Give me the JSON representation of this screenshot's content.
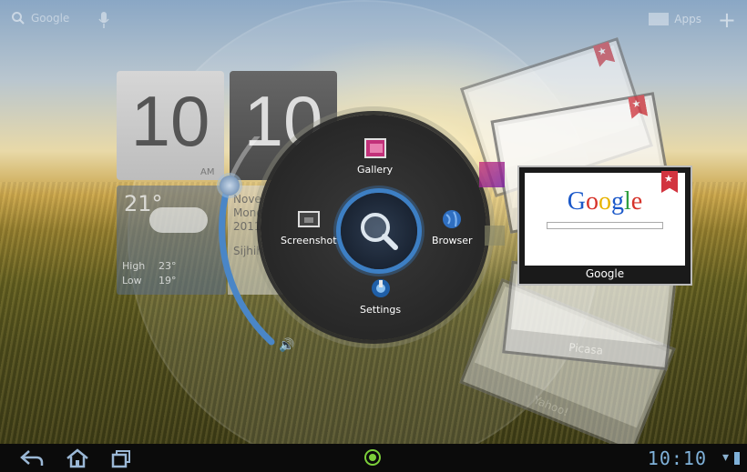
{
  "top_bar": {
    "search_label": "Google",
    "apps_label": "Apps",
    "add_glyph": "+"
  },
  "clock": {
    "hour": "10",
    "minute": "10",
    "ampm": "AM"
  },
  "weather": {
    "temp": "21°",
    "high_label": "High",
    "high": "23°",
    "low_label": "Low",
    "low": "19°"
  },
  "date_card": {
    "line1": "Nove",
    "line2": "Mond",
    "line3": "2011",
    "user": "Sijhih"
  },
  "ring_menu": {
    "gallery": "Gallery",
    "screenshot": "Screenshot",
    "browser": "Browser",
    "settings": "Settings"
  },
  "recent_cards": {
    "google": "Google",
    "picasa": "Picasa",
    "yahoo": "Yahoo!"
  },
  "status_bar": {
    "time": "10:10"
  },
  "colors": {
    "accent": "#3d7fc4",
    "launcher": "#7ccf3a",
    "clock_text": "#7fb1d9"
  }
}
